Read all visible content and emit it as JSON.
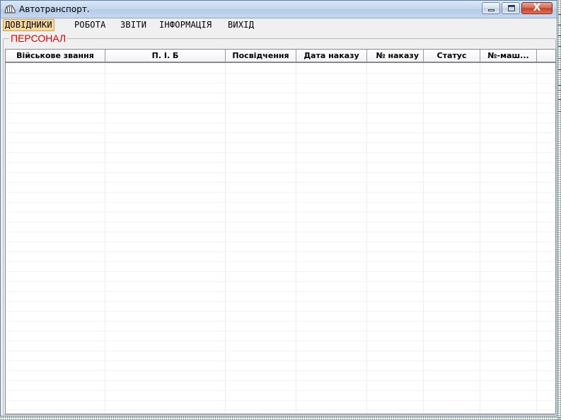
{
  "window": {
    "title": "Автотранспорт.",
    "minimize_glyph": "",
    "maximize_glyph": "",
    "close_glyph": "X"
  },
  "menu": {
    "items": [
      "ДОВІДНИКИ",
      "РОБОТА",
      "ЗВІТИ",
      "ІНФОРМАЦІЯ",
      "ВИХІД"
    ],
    "active_index": 0
  },
  "group": {
    "label": "ПЕРСОНАЛ",
    "label_color": "#e00000"
  },
  "grid": {
    "columns": [
      "Військове звання",
      "П. І. Б",
      "Посвідчення",
      "Дата наказу",
      "№ наказу",
      "Статус",
      "№-маш..."
    ],
    "rows": []
  },
  "colors": {
    "menu_highlight": "#fbd89a",
    "title_gradient_top": "#dbe8f6",
    "close_button": "#c73d22"
  }
}
